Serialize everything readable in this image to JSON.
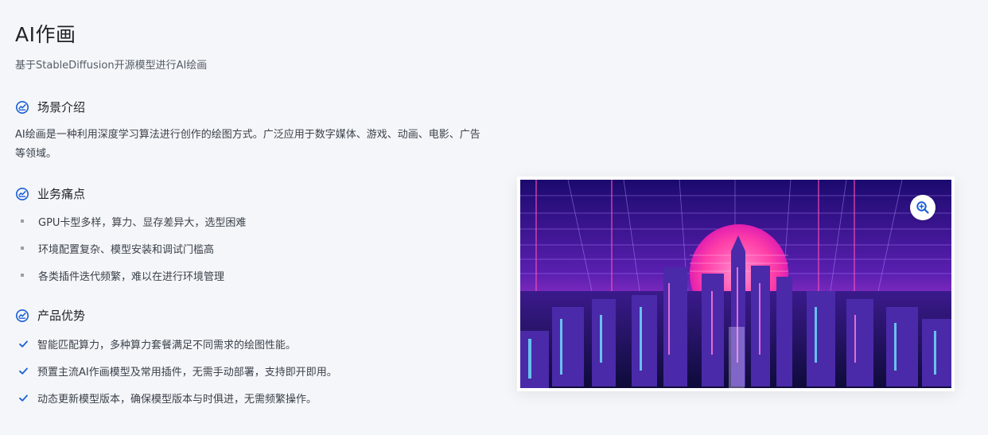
{
  "page": {
    "title": "AI作画",
    "subtitle": "基于StableDiffusion开源模型进行AI绘画"
  },
  "sections": {
    "intro": {
      "heading": "场景介绍",
      "text": "AI绘画是一种利用深度学习算法进行创作的绘图方式。广泛应用于数字媒体、游戏、动画、电影、广告等领域。",
      "icon": "scene-icon"
    },
    "pain_points": {
      "heading": "业务痛点",
      "icon": "scene-icon",
      "items": [
        "GPU卡型多样，算力、显存差异大，选型困难",
        "环境配置复杂、模型安装和调试门槛高",
        "各类插件迭代频繁，难以在进行环境管理"
      ]
    },
    "advantages": {
      "heading": "产品优势",
      "icon": "scene-icon",
      "items": [
        "智能匹配算力，多种算力套餐满足不同需求的绘图性能。",
        "预置主流AI作画模型及常用插件，无需手动部署，支持即开即用。",
        "动态更新模型版本，确保模型版本与时俱进，无需频繁操作。"
      ]
    }
  },
  "image": {
    "description_icon": "cyberpunk-city-illustration",
    "zoom_icon": "zoom-in-icon"
  },
  "colors": {
    "accent": "#1a5fd6",
    "background": "#f4f6f9",
    "text": "#1f2328"
  }
}
